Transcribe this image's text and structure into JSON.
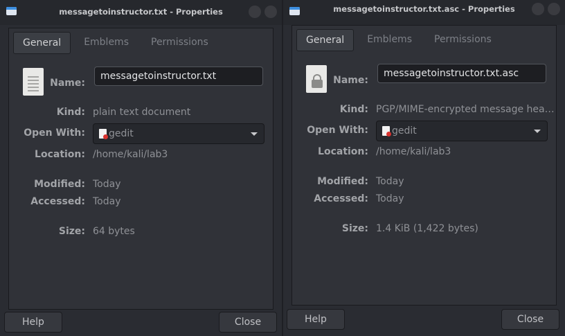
{
  "colors": {
    "window_bg": "#2a2c32",
    "panel_bg": "#303238",
    "field_bg": "#1d1e22",
    "gedit_accent": "#d8322e"
  },
  "windows": [
    {
      "title": "messagetoinstructor.txt - Properties",
      "tabs": [
        {
          "label": "General"
        },
        {
          "label": "Emblems"
        },
        {
          "label": "Permissions"
        }
      ],
      "active_tab": "General",
      "file_icon": "text-file-icon",
      "labels": {
        "name": "Name:",
        "kind": "Kind:",
        "open_with": "Open With:",
        "location": "Location:",
        "modified": "Modified:",
        "accessed": "Accessed:",
        "size": "Size:"
      },
      "name_value": "messagetoinstructor.txt",
      "kind": "plain text document",
      "open_with": "gedit",
      "location": "/home/kali/lab3",
      "modified": "Today",
      "accessed": "Today",
      "size": "64 bytes",
      "buttons": {
        "help": "Help",
        "close": "Close"
      }
    },
    {
      "title": "messagetoinstructor.txt.asc - Properties",
      "tabs": [
        {
          "label": "General"
        },
        {
          "label": "Emblems"
        },
        {
          "label": "Permissions"
        }
      ],
      "active_tab": "General",
      "file_icon": "locked-file-icon",
      "labels": {
        "name": "Name:",
        "kind": "Kind:",
        "open_with": "Open With:",
        "location": "Location:",
        "modified": "Modified:",
        "accessed": "Accessed:",
        "size": "Size:"
      },
      "name_value": "messagetoinstructor.txt.asc",
      "kind": "PGP/MIME-encrypted message hea…",
      "open_with": "gedit",
      "location": "/home/kali/lab3",
      "modified": "Today",
      "accessed": "Today",
      "size": "1.4 KiB (1,422 bytes)",
      "buttons": {
        "help": "Help",
        "close": "Close"
      }
    }
  ]
}
